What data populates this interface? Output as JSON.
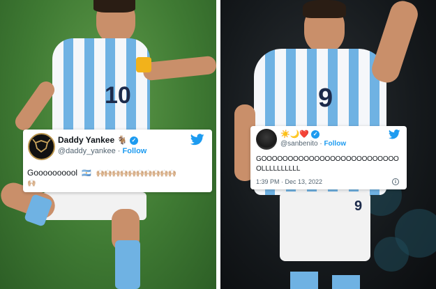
{
  "left_tweet": {
    "display_name": "Daddy Yankee",
    "name_emoji": "🐐",
    "handle": "@daddy_yankee",
    "separator": "·",
    "follow_label": "Follow",
    "text": "Goooooooool",
    "flag_emoji": "🇦🇷",
    "clap_emojis_line1": "🙌🏼🙌🏼🙌🏼🙌🏼🙌🏼🙌🏼🙌🏼🙌🏼🙌🏼🙌🏼",
    "clap_emojis_line2": "🙌🏼",
    "icons": [
      "avatar",
      "verified-badge-icon",
      "twitter-bird-icon"
    ]
  },
  "right_tweet": {
    "display_name_emojis": "☀️🌙❤️",
    "handle": "@sanbenito",
    "separator": "·",
    "follow_label": "Follow",
    "text_line1": "GOOOOOOOOOOOOOOOOOOOOOOOOOO",
    "text_line2": "OLLLLLLLLLL",
    "timestamp": "1:39 PM · Dec 13, 2022",
    "info_symbol": "i",
    "icons": [
      "avatar",
      "verified-badge-icon",
      "twitter-bird-icon",
      "info-icon"
    ]
  },
  "photos": {
    "left_jersey_number": "10",
    "right_jersey_number": "9",
    "right_shorts_number": "9"
  },
  "colors": {
    "twitter_blue": "#1d9bf0",
    "argentina_sky_blue": "#6fb2e3",
    "pitch_green": "#3f7a33",
    "stadium_dark": "#15191c"
  }
}
